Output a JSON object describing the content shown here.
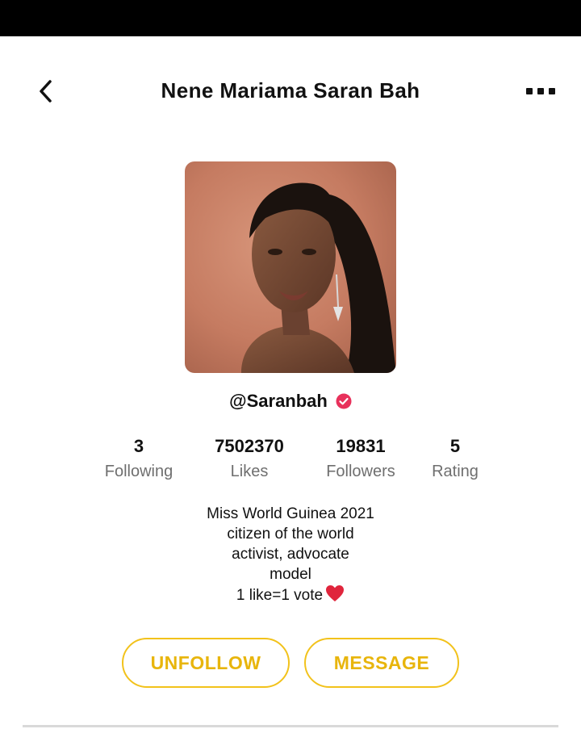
{
  "header": {
    "title": "Nene Mariama Saran Bah"
  },
  "profile": {
    "handle": "@Saranbah",
    "verified": true
  },
  "stats": [
    {
      "value": "3",
      "label": "Following"
    },
    {
      "value": "7502370",
      "label": "Likes"
    },
    {
      "value": "19831",
      "label": "Followers"
    },
    {
      "value": "5",
      "label": "Rating"
    }
  ],
  "bio": {
    "line1": "Miss World Guinea 2021",
    "line2": "citizen of the world",
    "line3": "activist, advocate",
    "line4": "model",
    "line5": "1 like=1 vote"
  },
  "actions": {
    "unfollow_label": "UNFOLLOW",
    "message_label": "MESSAGE"
  },
  "colors": {
    "accent": "#f2c21b",
    "accent_text": "#e8b50c",
    "verified_badge": "#e8315b",
    "heart": "#e0253c"
  }
}
